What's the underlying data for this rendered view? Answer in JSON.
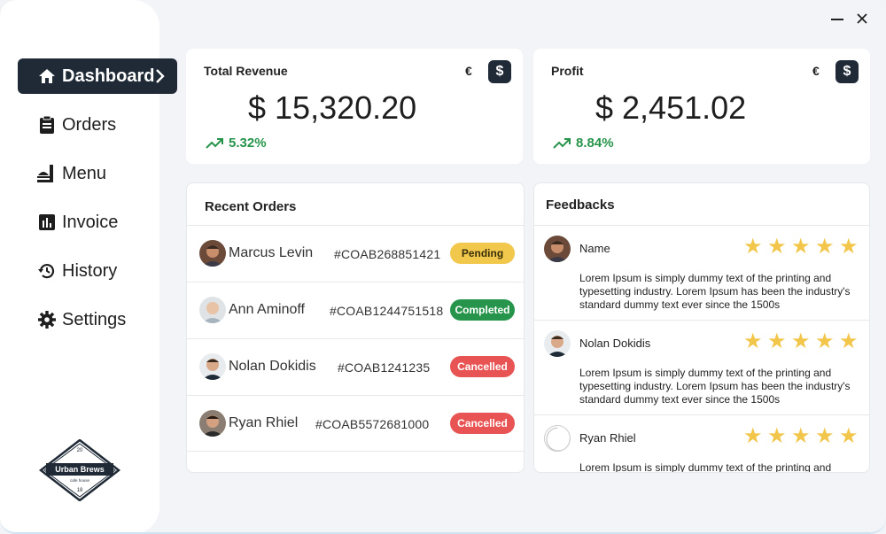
{
  "window": {
    "minimize_icon": "minimize-icon",
    "close_icon": "close-icon"
  },
  "sidebar": {
    "items": [
      {
        "label": "Dashboard",
        "icon": "home-icon",
        "active": true
      },
      {
        "label": "Orders",
        "icon": "clipboard-icon"
      },
      {
        "label": "Menu",
        "icon": "food-tray-icon"
      },
      {
        "label": "Invoice",
        "icon": "bar-chart-icon"
      },
      {
        "label": "History",
        "icon": "history-icon"
      },
      {
        "label": "Settings",
        "icon": "gear-icon"
      }
    ],
    "logo": {
      "name": "Urban Brews",
      "tagline": "cafe house",
      "year_top": "20",
      "year_bottom": "18"
    }
  },
  "kpis": {
    "revenue": {
      "title": "Total Revenue",
      "currency_euro": "€",
      "currency_dollar": "$",
      "value": "$ 15,320.20",
      "trend": "5.32%"
    },
    "profit": {
      "title": "Profit",
      "currency_euro": "€",
      "currency_dollar": "$",
      "value": "$ 2,451.02",
      "trend": "8.84%"
    }
  },
  "orders": {
    "title": "Recent Orders",
    "rows": [
      {
        "name": "Marcus Levin",
        "id": "#COAB268851421",
        "status": "Pending"
      },
      {
        "name": "Ann Aminoff",
        "id": "#COAB1244751518",
        "status": "Completed"
      },
      {
        "name": "Nolan Dokidis",
        "id": "#COAB1241235",
        "status": "Cancelled"
      },
      {
        "name": "Ryan Rhiel",
        "id": "#COAB5572681000",
        "status": "Cancelled"
      }
    ]
  },
  "feedbacks": {
    "title": "Feedbacks",
    "items": [
      {
        "name": "Name",
        "rating": 5,
        "text": "Lorem Ipsum is simply dummy text of the printing and typesetting industry. Lorem Ipsum has been the industry's standard dummy text ever since the 1500s"
      },
      {
        "name": "Nolan Dokidis",
        "rating": 5,
        "text": "Lorem Ipsum is simply dummy text of the printing and typesetting industry. Lorem Ipsum has been the industry's standard dummy text ever since the 1500s"
      },
      {
        "name": "Ryan Rhiel",
        "rating": 5,
        "text": "Lorem Ipsum is simply dummy text of the printing and"
      }
    ]
  },
  "colors": {
    "dark": "#1f2a36",
    "green": "#27944b",
    "pending": "#f1c84b",
    "cancelled": "#e85454",
    "star": "#f2c64a"
  }
}
